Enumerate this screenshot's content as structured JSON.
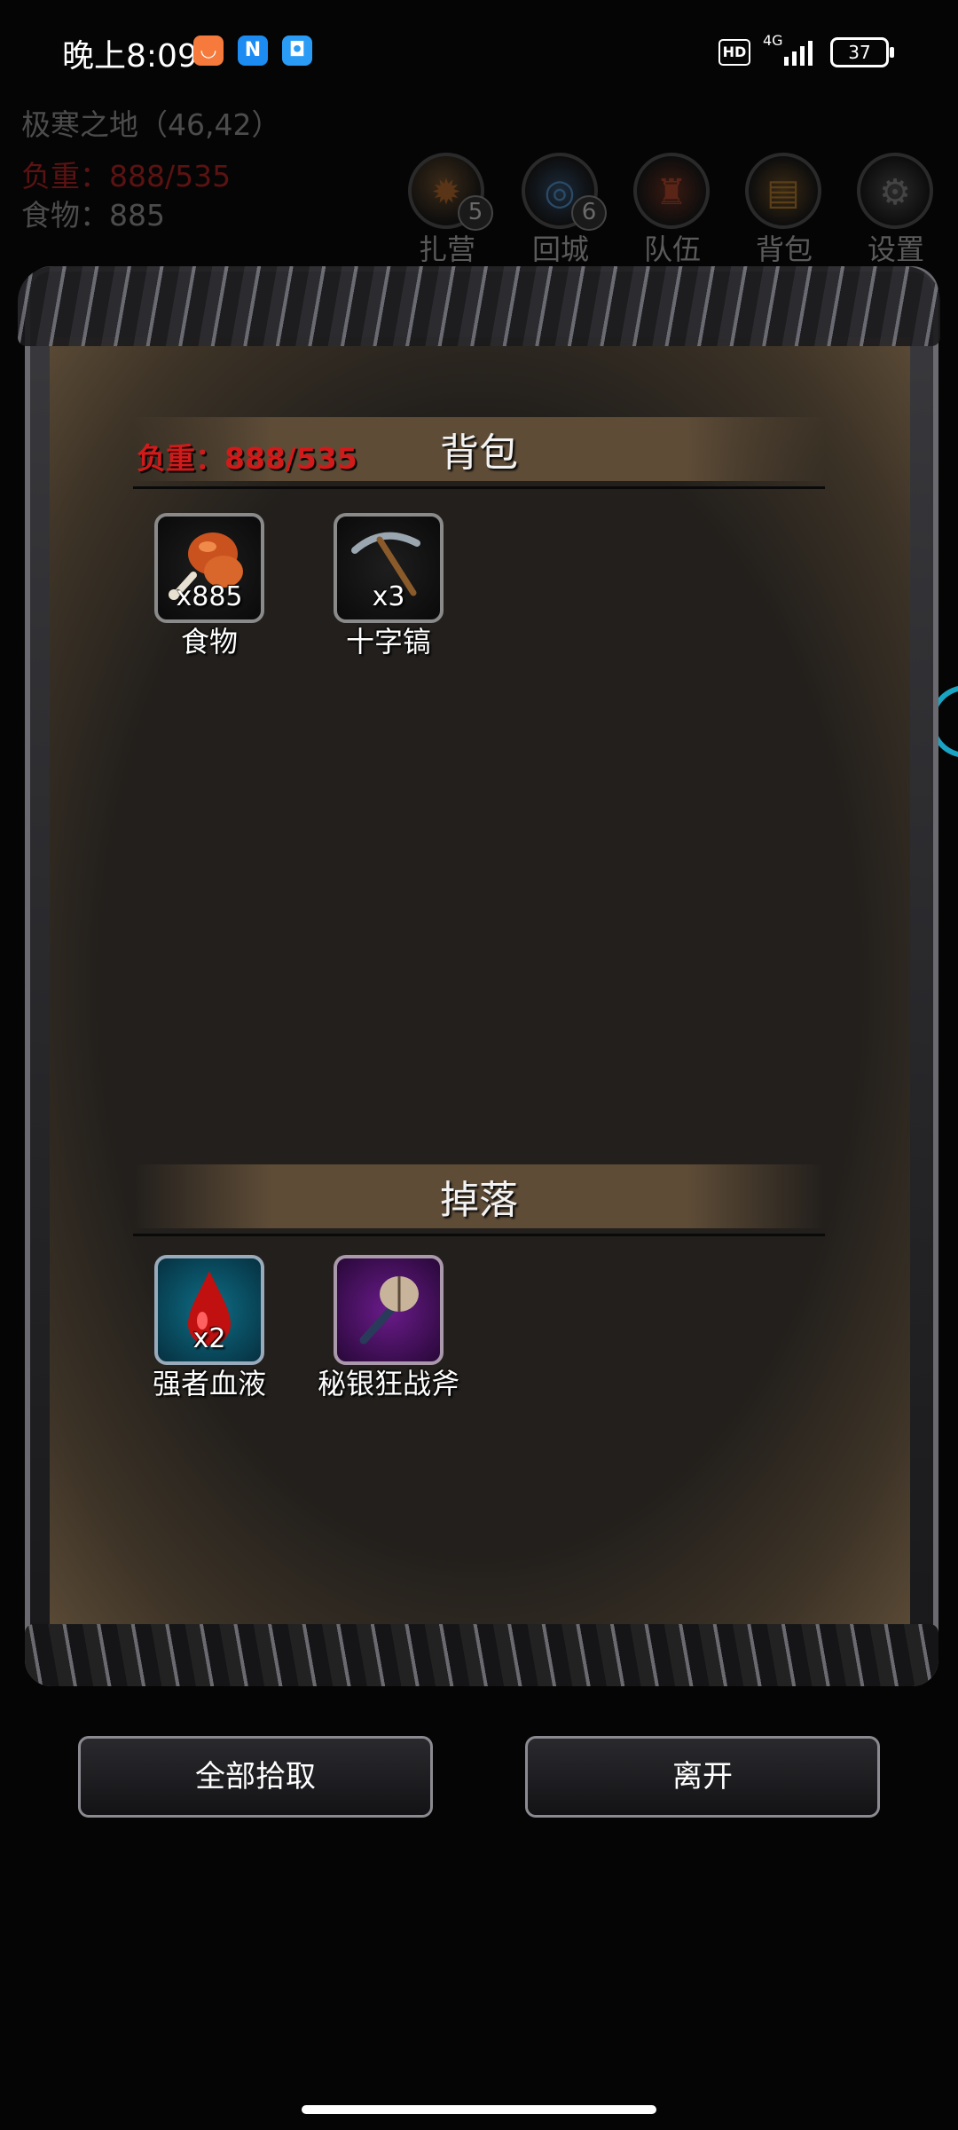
{
  "status_bar": {
    "time": "晚上8:09",
    "hd": "HD",
    "network": "4G",
    "battery": "37",
    "app_icons": [
      "mi-store-icon",
      "n-app-icon",
      "chat-app-icon"
    ]
  },
  "game_header": {
    "location": "极寒之地（46,42）",
    "load": "负重：888/535",
    "food": "食物：885"
  },
  "nav": [
    {
      "label": "扎营",
      "icon": "campfire-icon",
      "badge": "5"
    },
    {
      "label": "回城",
      "icon": "portal-icon",
      "badge": "6"
    },
    {
      "label": "队伍",
      "icon": "team-icon",
      "badge": ""
    },
    {
      "label": "背包",
      "icon": "barrel-icon",
      "badge": ""
    },
    {
      "label": "设置",
      "icon": "gear-icon",
      "badge": ""
    }
  ],
  "backpack": {
    "title": "背包",
    "load": "负重：888/535",
    "items": [
      {
        "name": "食物",
        "count": "x885",
        "icon": "drumstick-icon"
      },
      {
        "name": "十字镐",
        "count": "x3",
        "icon": "pickaxe-icon"
      }
    ]
  },
  "drops": {
    "title": "掉落",
    "items": [
      {
        "name": "强者血液",
        "count": "x2",
        "icon": "blood-drop-icon"
      },
      {
        "name": "秘银狂战斧",
        "count": "",
        "icon": "battle-axe-icon"
      }
    ]
  },
  "actions": {
    "pickup_all": "全部拾取",
    "leave": "离开"
  },
  "colors": {
    "load_red": "#d11b1b",
    "rare_item_bg": "#0e6e86",
    "epic_item_bg": "#6a1b8a"
  }
}
